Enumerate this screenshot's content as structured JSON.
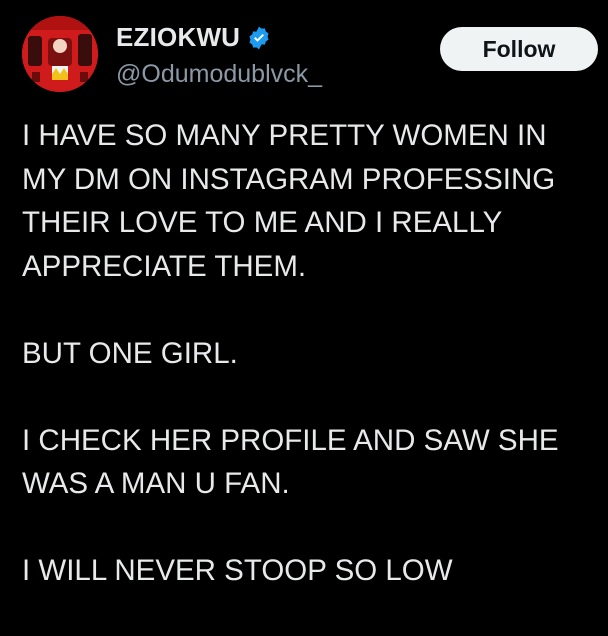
{
  "author": {
    "display_name": "EZIOKWU",
    "handle": "@Odumodublvck_",
    "verified": true,
    "avatar_icon": "profile-avatar-red"
  },
  "follow_button": {
    "label": "Follow"
  },
  "tweet": {
    "paragraphs": [
      [
        "I HAVE SO MANY PRETTY WOMEN IN",
        "MY DM ON INSTAGRAM PROFESSING",
        "THEIR LOVE TO ME AND I REALLY",
        "APPRECIATE THEM."
      ],
      [
        "BUT ONE GIRL."
      ],
      [
        "I CHECK HER PROFILE AND SAW SHE",
        "WAS A MAN U FAN."
      ],
      [
        "I WILL NEVER STOOP SO LOW"
      ]
    ]
  },
  "colors": {
    "background": "#000000",
    "text": "#e7e9ea",
    "secondary_text": "#8b98a5",
    "verified_badge": "#1d9bf0",
    "follow_bg": "#eff3f4",
    "follow_text": "#0f1419"
  }
}
